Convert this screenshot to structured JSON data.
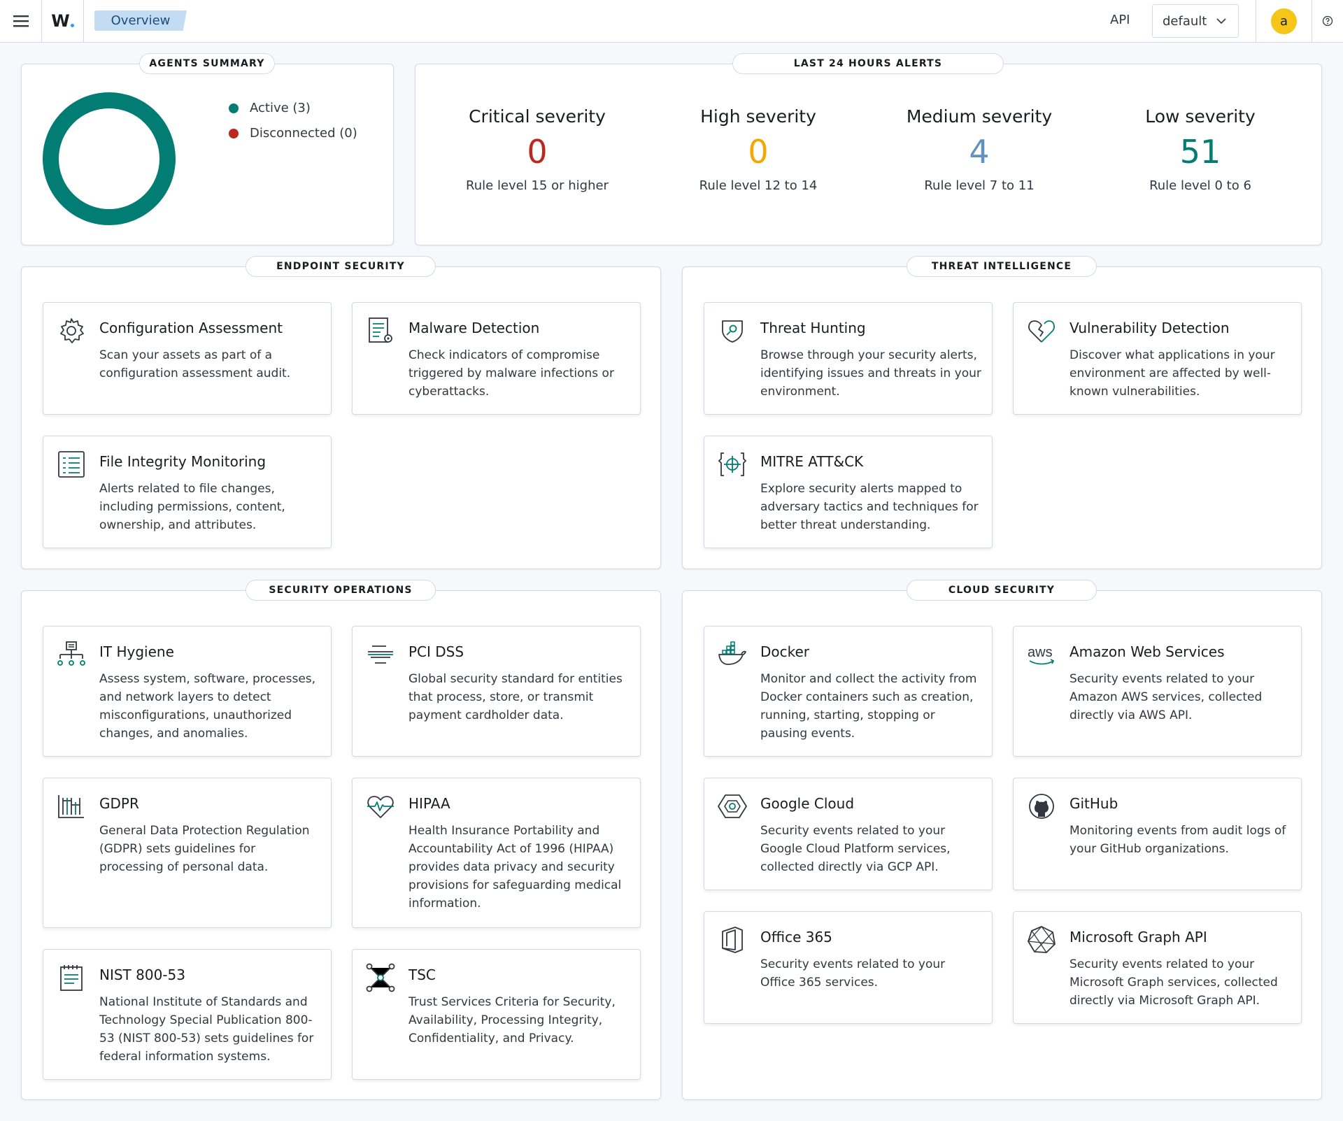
{
  "header": {
    "breadcrumb": "Overview",
    "api_label": "API",
    "env_selected": "default",
    "avatar_initial": "a"
  },
  "agents_summary": {
    "title": "AGENTS SUMMARY",
    "active_label": "Active (3)",
    "disconnected_label": "Disconnected (0)",
    "active_color": "#017d73",
    "disconnected_color": "#bd271e"
  },
  "alerts": {
    "title": "LAST 24 HOURS ALERTS",
    "items": [
      {
        "title": "Critical severity",
        "value": "0",
        "sub": "Rule level 15 or higher",
        "color": "#bd271e"
      },
      {
        "title": "High severity",
        "value": "0",
        "sub": "Rule level 12 to 14",
        "color": "#f5a700"
      },
      {
        "title": "Medium severity",
        "value": "4",
        "sub": "Rule level 7 to 11",
        "color": "#6092c0"
      },
      {
        "title": "Low severity",
        "value": "51",
        "sub": "Rule level 0 to 6",
        "color": "#017d73"
      }
    ]
  },
  "sections": {
    "endpoint": {
      "title": "ENDPOINT SECURITY",
      "cards": [
        {
          "title": "Configuration Assessment",
          "desc": "Scan your assets as part of a configuration assessment audit."
        },
        {
          "title": "Malware Detection",
          "desc": "Check indicators of compromise triggered by malware infections or cyberattacks."
        },
        {
          "title": "File Integrity Monitoring",
          "desc": "Alerts related to file changes, including permissions, content, ownership, and attributes."
        }
      ]
    },
    "threat": {
      "title": "THREAT INTELLIGENCE",
      "cards": [
        {
          "title": "Threat Hunting",
          "desc": "Browse through your security alerts, identifying issues and threats in your environment."
        },
        {
          "title": "Vulnerability Detection",
          "desc": "Discover what applications in your environment are affected by well-known vulnerabilities."
        },
        {
          "title": "MITRE ATT&CK",
          "desc": "Explore security alerts mapped to adversary tactics and techniques for better threat understanding."
        }
      ]
    },
    "secops": {
      "title": "SECURITY OPERATIONS",
      "cards": [
        {
          "title": "IT Hygiene",
          "desc": "Assess system, software, processes, and network layers to detect misconfigurations, unauthorized changes, and anomalies."
        },
        {
          "title": "PCI DSS",
          "desc": "Global security standard for entities that process, store, or transmit payment cardholder data."
        },
        {
          "title": "GDPR",
          "desc": "General Data Protection Regulation (GDPR) sets guidelines for processing of personal data."
        },
        {
          "title": "HIPAA",
          "desc": "Health Insurance Portability and Accountability Act of 1996 (HIPAA) provides data privacy and security provisions for safeguarding medical information."
        },
        {
          "title": "NIST 800-53",
          "desc": "National Institute of Standards and Technology Special Publication 800-53 (NIST 800-53) sets guidelines for federal information systems."
        },
        {
          "title": "TSC",
          "desc": "Trust Services Criteria for Security, Availability, Processing Integrity, Confidentiality, and Privacy."
        }
      ]
    },
    "cloud": {
      "title": "CLOUD SECURITY",
      "cards": [
        {
          "title": "Docker",
          "desc": "Monitor and collect the activity from Docker containers such as creation, running, starting, stopping or pausing events."
        },
        {
          "title": "Amazon Web Services",
          "desc": "Security events related to your Amazon AWS services, collected directly via AWS API."
        },
        {
          "title": "Google Cloud",
          "desc": "Security events related to your Google Cloud Platform services, collected directly via GCP API."
        },
        {
          "title": "GitHub",
          "desc": "Monitoring events from audit logs of your GitHub organizations."
        },
        {
          "title": "Office 365",
          "desc": "Security events related to your Office 365 services."
        },
        {
          "title": "Microsoft Graph API",
          "desc": "Security events related to your Microsoft Graph services, collected directly via Microsoft Graph API."
        }
      ]
    }
  },
  "icons": {
    "aws_text": "aws"
  }
}
